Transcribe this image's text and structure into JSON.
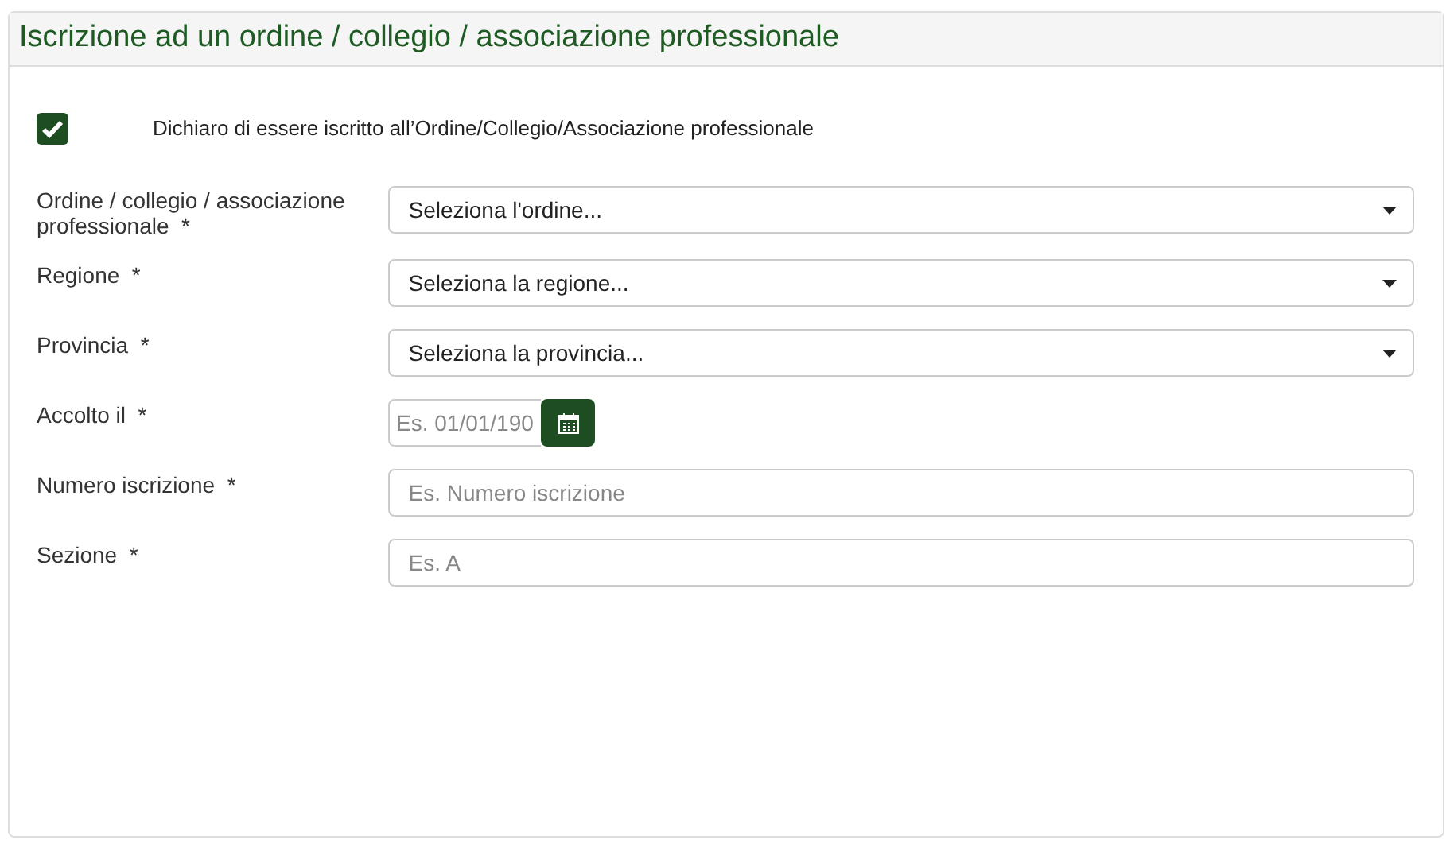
{
  "panel": {
    "title": "Iscrizione ad un ordine / collegio / associazione professionale"
  },
  "declaration": {
    "checked": true,
    "label": "Dichiaro di essere iscritto all’Ordine/Collegio/Associazione professionale"
  },
  "fields": [
    {
      "kind": "select",
      "label": "Ordine / collegio / associazione professionale  *",
      "placeholder": "Seleziona l'ordine..."
    },
    {
      "kind": "select",
      "label": "Regione  *",
      "placeholder": "Seleziona la regione..."
    },
    {
      "kind": "select",
      "label": "Provincia  *",
      "placeholder": "Seleziona la provincia..."
    },
    {
      "kind": "date",
      "label": "Accolto il  *",
      "placeholder": "Es. 01/01/190"
    },
    {
      "kind": "text",
      "label": "Numero iscrizione  *",
      "placeholder": "Es. Numero iscrizione"
    },
    {
      "kind": "text",
      "label": "Sezione  *",
      "placeholder": "Es. A"
    }
  ]
}
